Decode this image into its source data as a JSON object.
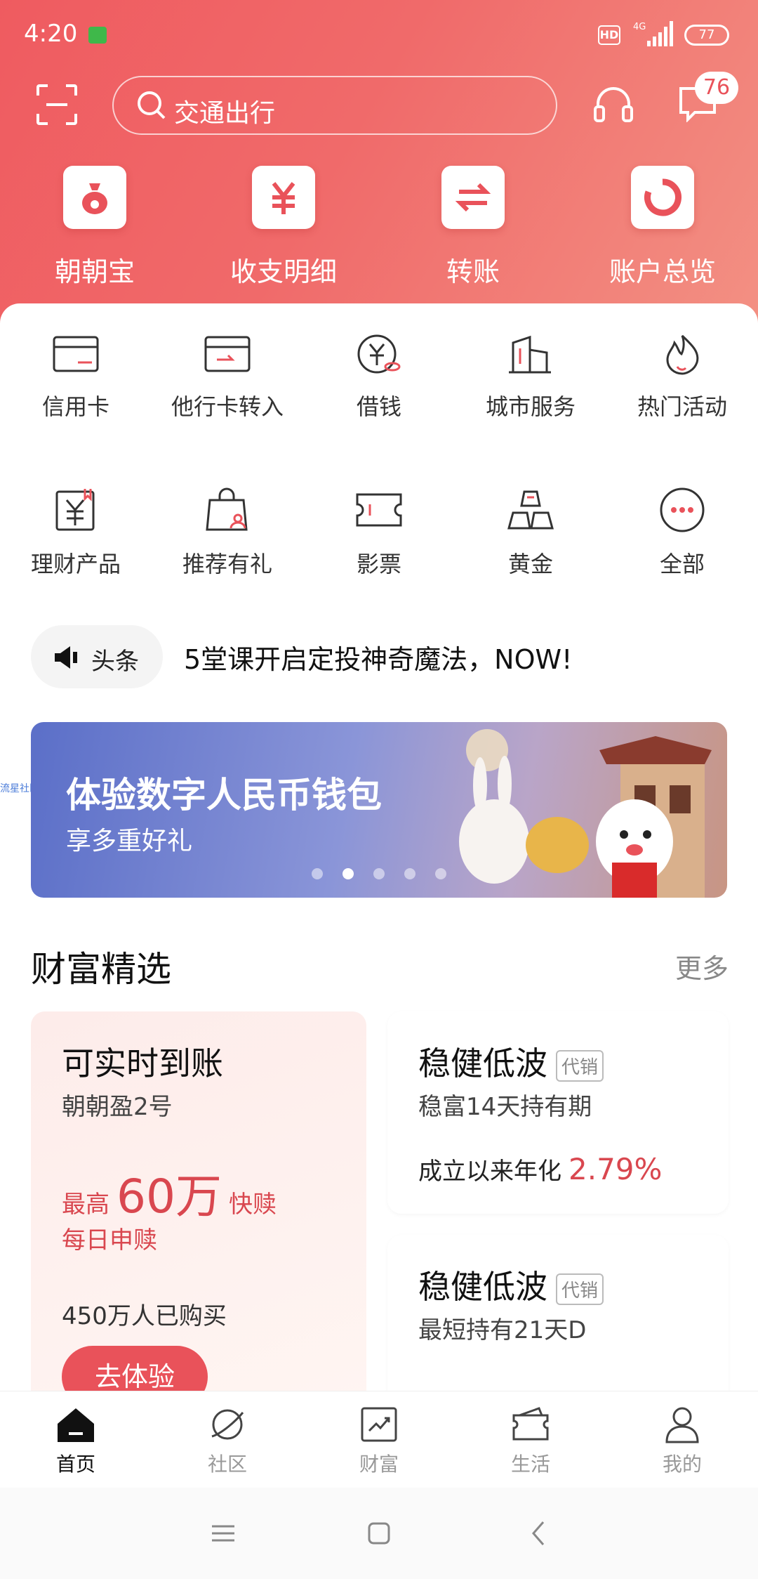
{
  "status_bar": {
    "time": "4:20",
    "hd_label": "HD",
    "network": "4G",
    "battery": "77"
  },
  "header": {
    "search_placeholder": "交通出行",
    "message_badge": "76"
  },
  "top_actions": [
    {
      "label": "朝朝宝",
      "icon": "money-bag-icon"
    },
    {
      "label": "收支明细",
      "icon": "yuan-icon"
    },
    {
      "label": "转账",
      "icon": "transfer-arrows-icon"
    },
    {
      "label": "账户总览",
      "icon": "donut-chart-icon"
    }
  ],
  "services": {
    "row1": [
      {
        "label": "信用卡",
        "icon": "credit-card-icon"
      },
      {
        "label": "他行卡转入",
        "icon": "card-transfer-icon"
      },
      {
        "label": "借钱",
        "icon": "loan-coin-icon"
      },
      {
        "label": "城市服务",
        "icon": "city-buildings-icon"
      },
      {
        "label": "热门活动",
        "icon": "flame-icon"
      }
    ],
    "row2": [
      {
        "label": "理财产品",
        "icon": "wealth-doc-icon"
      },
      {
        "label": "推荐有礼",
        "icon": "gift-bag-icon"
      },
      {
        "label": "影票",
        "icon": "ticket-icon"
      },
      {
        "label": "黄金",
        "icon": "gold-bars-icon"
      },
      {
        "label": "全部",
        "icon": "more-dots-icon"
      }
    ]
  },
  "headline": {
    "tag": "头条",
    "text": "5堂课开启定投神奇魔法，NOW!"
  },
  "banner": {
    "title": "体验数字人民币钱包",
    "subtitle": "享多重好礼",
    "active_slide": 2,
    "slide_count": 5
  },
  "side_overlay": "流星社区",
  "wealth": {
    "title": "财富精选",
    "more": "更多",
    "promo_card": {
      "title": "可实时到账",
      "subtitle": "朝朝盈2号",
      "prefix": "最高",
      "amount": "60万",
      "suffix": "快赎",
      "daily": "每日申赎",
      "buyers": "450万人已购买",
      "button": "去体验"
    },
    "card1": {
      "title": "稳健低波",
      "tag": "代销",
      "subtitle": "稳富14天持有期",
      "yield_label": "成立以来年化",
      "yield_value": "2.79%"
    },
    "card2": {
      "title": "稳健低波",
      "tag": "代销",
      "subtitle": "最短持有21天D"
    }
  },
  "tabs": [
    {
      "label": "首页",
      "icon": "home-icon",
      "active": true
    },
    {
      "label": "社区",
      "icon": "planet-icon",
      "active": false
    },
    {
      "label": "财富",
      "icon": "trend-chart-icon",
      "active": false
    },
    {
      "label": "生活",
      "icon": "ticket-wallet-icon",
      "active": false
    },
    {
      "label": "我的",
      "icon": "user-icon",
      "active": false
    }
  ],
  "colors": {
    "accent": "#e9525a",
    "hero_start": "#ef5b60",
    "hero_end": "#f39083"
  }
}
